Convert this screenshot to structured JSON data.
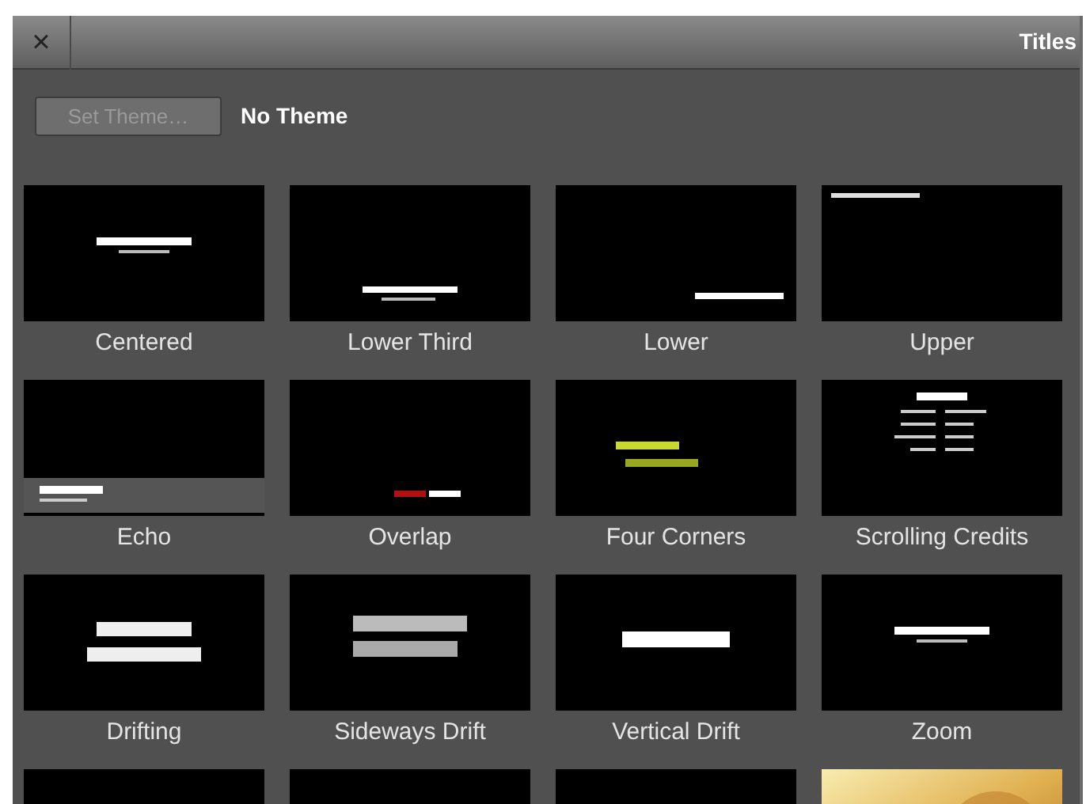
{
  "window": {
    "title": "Titles",
    "close": "×"
  },
  "theme_bar": {
    "button": {
      "label": "Set Theme…",
      "disabled": true
    },
    "current": "No Theme"
  },
  "tiles": [
    {
      "label": "Centered",
      "kind": "center"
    },
    {
      "label": "Lower Third",
      "kind": "lower-third"
    },
    {
      "label": "Lower",
      "kind": "lower-right"
    },
    {
      "label": "Upper",
      "kind": "upper-left"
    },
    {
      "label": "Echo",
      "kind": "echo"
    },
    {
      "label": "Overlap",
      "kind": "overlap"
    },
    {
      "label": "Four Corners",
      "kind": "corners"
    },
    {
      "label": "Scrolling Credits",
      "kind": "credits"
    },
    {
      "label": "Drifting",
      "kind": "two-line"
    },
    {
      "label": "Sideways Drift",
      "kind": "serif"
    },
    {
      "label": "Vertical Drift",
      "kind": "bold"
    },
    {
      "label": "Zoom",
      "kind": "center"
    },
    {
      "kind": "blank"
    },
    {
      "kind": "blank"
    },
    {
      "kind": "blank"
    },
    {
      "kind": "gold"
    }
  ]
}
